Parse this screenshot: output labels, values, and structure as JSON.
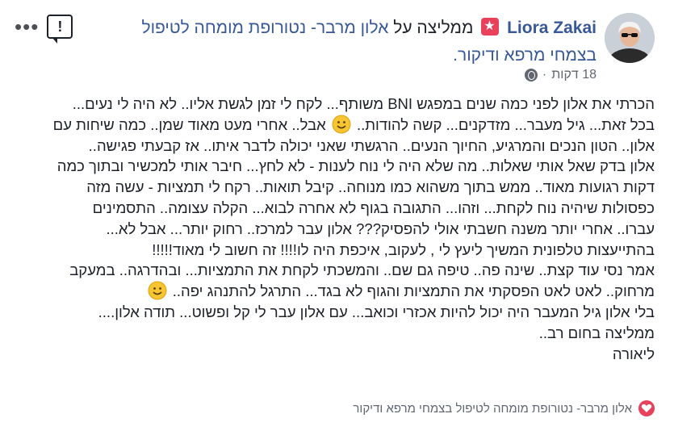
{
  "post": {
    "author": "Liora Zakai",
    "action_text": "ממליצה על",
    "page_name": "אלון מרבר- נטורופת מומחה לטיפול בצמחי מרפא ודיקור.",
    "time": "18 דקות",
    "more_icon": "more-dots-icon",
    "report_icon": "report-icon",
    "body_lines": [
      "הכרתי את אלון לפני כמה שנים במפגש BNI משותף... לקח לי זמן לגשת אליו.. לא היה לי נעים...",
      "בכל זאת... גיל מעבר... מזדקנים... קשה להודות..",
      "אלון.. הטון הנכים והמרגיע, החיוך הנעים.. הרגשתי שאני יכולה לדבר איתו.. אז קבעתי פגישה..",
      "אלון בדק שאל אותי שאלות.. מה שלא היה לי נוח לענות - לא לחץ... חיבר אותי למכשיר ובתוך כמה",
      "דקות רגועות מאוד.. ממש בתוך משהוא כמו מנוחה.. קיבל תואות.. רקח לי תמציות - עשה מזה",
      "כפסולות שיהיה נוח לקחת... וזהו... התגובה בגוף לא אחרה לבוא... הקלה עצומה.. התסמינים",
      "עברו.. אחרי יותר משנה חשבתי אולי להפסיק??? אלון עבר למרכז.. רחוק יותר... אבל לא...",
      "בהתייעצות טלפונית המשיך ליעץ לי , לעקוב, איכפת היה לו!!!! זה חשוב לי מאוד!!!!!",
      "אמר נסי עוד קצת.. שינה פה.. טיפה גם שם.. והמשכתי לקחת את התמציות... ובהדרגה.. במעקב",
      "מרחוק.. לאט לאט הפסקתי את התמציות והגוף לא בגד... התרגל להתנהג יפה..",
      "בלי אלון גיל המעבר היה יכול להיות אכזרי וכואב... עם אלון עבר לי קל ופשוט... תודה אלון....",
      "ממליצה בחום רב..",
      "ליאורה"
    ],
    "inline_tail_line1": "אבל.. אחרי מעט מאוד שמן.. כמה שיחות עם",
    "emoji_icon": "smiley-emoji-icon",
    "footer_page": "אלון מרבר- נטורופת מומחה לטיפול בצמחי מרפא ודיקור",
    "footer_icon": "heart-icon",
    "colors": {
      "link": "#385898",
      "badge": "#e9415c",
      "text": "#1d2129",
      "meta": "#606770"
    }
  }
}
